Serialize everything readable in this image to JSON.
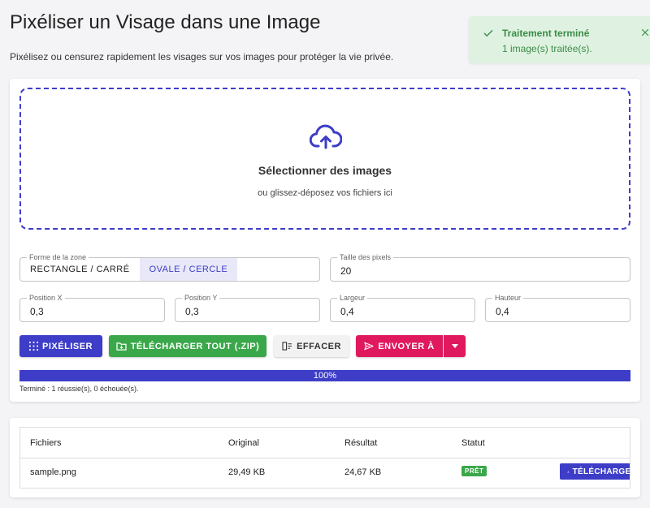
{
  "header": {
    "title": "Pixéliser un Visage dans une Image",
    "subtitle": "Pixélisez ou censurez rapidement les visages sur vos images pour protéger la vie privée."
  },
  "toast": {
    "title": "Traitement terminé",
    "message": "1 image(s) traitée(s).",
    "icon": "check-icon",
    "color": "#3a8c46"
  },
  "dropzone": {
    "title": "Sélectionner des images",
    "subtitle": "ou glissez-déposez vos fichiers ici",
    "icon": "cloud-upload-icon"
  },
  "settings": {
    "shape": {
      "label": "Forme de la zone",
      "options": [
        "RECTANGLE / CARRÉ",
        "OVALE / CERCLE"
      ],
      "selected": "OVALE / CERCLE"
    },
    "pixel_size": {
      "label": "Taille des pixels",
      "value": "20"
    },
    "position_x": {
      "label": "Position X",
      "value": "0,3"
    },
    "position_y": {
      "label": "Position Y",
      "value": "0,3"
    },
    "width": {
      "label": "Largeur",
      "value": "0,4"
    },
    "height": {
      "label": "Hauteur",
      "value": "0,4"
    }
  },
  "actions": {
    "pixelize": "PIXÉLISER",
    "download_zip": "TÉLÉCHARGER TOUT (.ZIP)",
    "clear": "EFFACER",
    "send": "ENVOYER À"
  },
  "progress": {
    "percent": 100,
    "label": "100%",
    "status": "Terminé : 1 réussie(s), 0 échouée(s)."
  },
  "table": {
    "headers": [
      "Fichiers",
      "Original",
      "Résultat",
      "Statut"
    ],
    "rows": [
      {
        "file": "sample.png",
        "original": "29,49 KB",
        "result": "24,67 KB",
        "status": "PRÊT",
        "action": "TÉLÉCHARGER"
      }
    ]
  },
  "colors": {
    "primary": "#3d3dc8",
    "success": "#3aa74a",
    "accent": "#e0195f"
  }
}
